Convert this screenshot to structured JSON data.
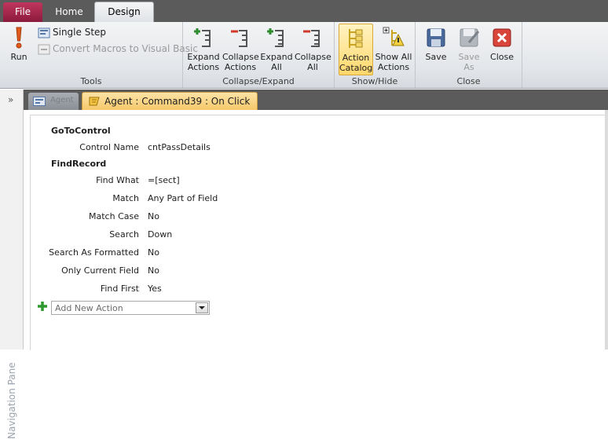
{
  "tabs": {
    "file": "File",
    "home": "Home",
    "design": "Design"
  },
  "ribbon": {
    "run": "Run",
    "single_step": "Single Step",
    "convert_macros": "Convert Macros to Visual Basic",
    "tools_label": "Tools",
    "expand_actions": [
      "Expand",
      "Actions"
    ],
    "collapse_actions": [
      "Collapse",
      "Actions"
    ],
    "expand_all": [
      "Expand",
      "All"
    ],
    "collapse_all": [
      "Collapse",
      "All"
    ],
    "collapse_expand_label": "Collapse/Expand",
    "action_catalog": [
      "Action",
      "Catalog"
    ],
    "show_all_actions": [
      "Show All",
      "Actions"
    ],
    "show_hide_label": "Show/Hide",
    "save": "Save",
    "save_as": [
      "Save",
      "As"
    ],
    "close": "Close",
    "close_group_label": "Close"
  },
  "nav": {
    "toggle": "»",
    "label": "Navigation Pane"
  },
  "doc_tabs": {
    "other": "Agent",
    "active": "Agent : Command39 : On Click"
  },
  "macro": {
    "actions": [
      {
        "name": "GoToControl",
        "args": [
          {
            "label": "Control Name",
            "value": "cntPassDetails"
          }
        ]
      },
      {
        "name": "FindRecord",
        "args": [
          {
            "label": "Find What",
            "value": "=[sect]"
          },
          {
            "label": "Match",
            "value": "Any Part of Field"
          },
          {
            "label": "Match Case",
            "value": "No"
          },
          {
            "label": "Search",
            "value": "Down"
          },
          {
            "label": "Search As Formatted",
            "value": "No"
          },
          {
            "label": "Only Current Field",
            "value": "No"
          },
          {
            "label": "Find First",
            "value": "Yes"
          }
        ]
      }
    ],
    "add_new_action": "Add New Action"
  },
  "colors": {
    "file_tab": "#b02c54",
    "tab_bar": "#5b5b5b",
    "active_doc_tab": "#f6c86a"
  }
}
